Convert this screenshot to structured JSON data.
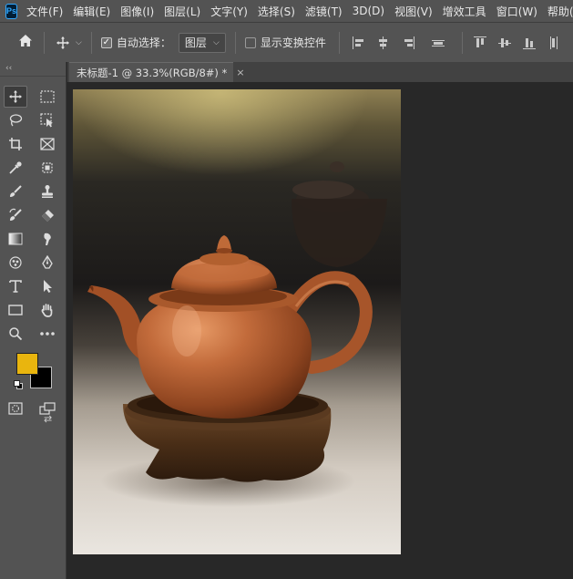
{
  "app": {
    "logo_text": "Ps"
  },
  "menu": [
    "文件(F)",
    "编辑(E)",
    "图像(I)",
    "图层(L)",
    "文字(Y)",
    "选择(S)",
    "滤镜(T)",
    "3D(D)",
    "视图(V)",
    "增效工具",
    "窗口(W)",
    "帮助(H)"
  ],
  "options": {
    "auto_select_label": "自动选择：",
    "auto_select_checked": true,
    "layer_select_value": "图层",
    "show_transform_label": "显示变换控件",
    "show_transform_checked": false
  },
  "tools_panel": {
    "collapse_label": "‹‹",
    "icons": [
      "move-icon",
      "rect-marquee-icon",
      "lasso-icon",
      "object-select-icon",
      "crop-icon",
      "frame-icon",
      "eyedropper-icon",
      "healing-brush-icon",
      "brush-icon",
      "stamp-icon",
      "history-brush-icon",
      "eraser-icon",
      "gradient-icon",
      "smudge-icon",
      "dodge-icon",
      "pen-icon",
      "type-icon",
      "path-select-icon",
      "rectangle-icon",
      "hand-icon",
      "zoom-icon",
      "more-tools-icon",
      "quick-mask-icon",
      "screen-mode-icon"
    ],
    "foreground_color": "#E9B50E",
    "background_color": "#000000"
  },
  "document": {
    "tab_title": "未标题-1 @ 33.3%(RGB/8#) *",
    "close_glyph": "×"
  }
}
